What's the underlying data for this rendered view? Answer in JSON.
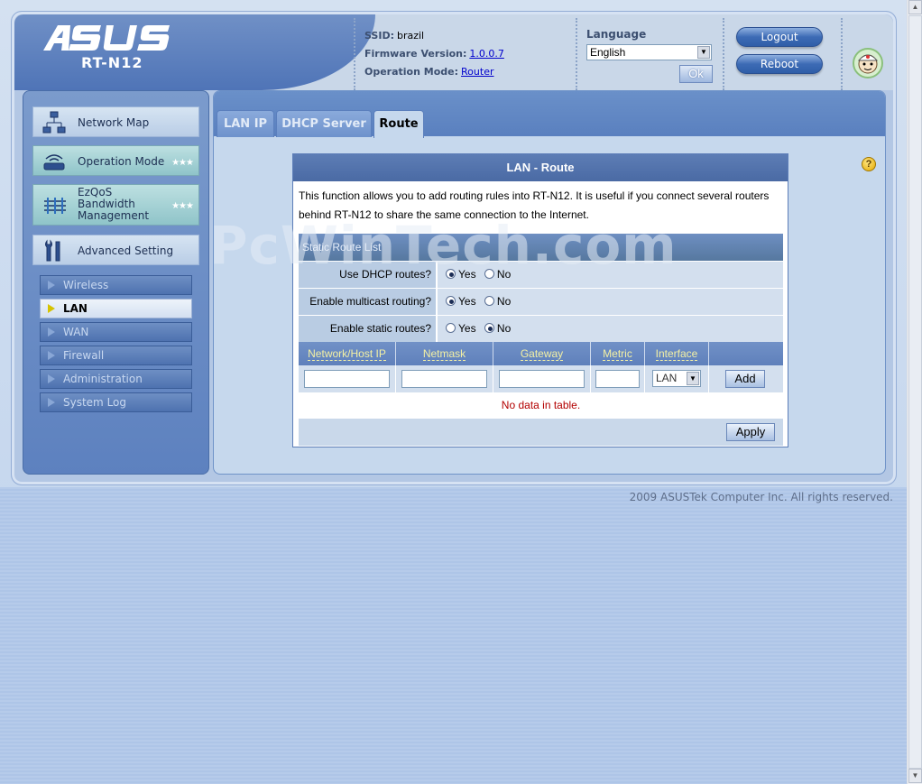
{
  "header": {
    "brand": "ASUS",
    "model": "RT-N12",
    "ssid_label": "SSID:",
    "ssid": "brazil",
    "firmware_label": "Firmware Version:",
    "firmware": "1.0.0.7",
    "opmode_label": "Operation Mode:",
    "opmode": "Router",
    "language_label": "Language",
    "language": "English",
    "ok_label": "Ok",
    "logout_label": "Logout",
    "reboot_label": "Reboot"
  },
  "sidebar": {
    "main": [
      {
        "label": "Network Map",
        "icon": "network-map-icon"
      },
      {
        "label": "Operation Mode",
        "icon": "router-icon"
      },
      {
        "label": "EzQoS Bandwidth Management",
        "label_lines": [
          "EzQoS",
          "Bandwidth",
          "Management"
        ],
        "icon": "qos-icon"
      },
      {
        "label": "Advanced Setting",
        "icon": "tools-icon"
      }
    ],
    "sub": [
      {
        "label": "Wireless",
        "active": false
      },
      {
        "label": "LAN",
        "active": true
      },
      {
        "label": "WAN",
        "active": false
      },
      {
        "label": "Firewall",
        "active": false
      },
      {
        "label": "Administration",
        "active": false
      },
      {
        "label": "System Log",
        "active": false
      }
    ]
  },
  "tabs": [
    {
      "label": "LAN IP",
      "active": false
    },
    {
      "label": "DHCP Server",
      "active": false
    },
    {
      "label": "Route",
      "active": true
    }
  ],
  "panel": {
    "title": "LAN - Route",
    "description": "This function allows you to add routing rules into RT-N12. It is useful if you connect several routers behind RT-N12 to share the same connection to the Internet.",
    "section_title": "Static Route List",
    "options": [
      {
        "label": "Use DHCP routes?",
        "yes": "Yes",
        "no": "No",
        "value": "yes"
      },
      {
        "label": "Enable multicast routing?",
        "yes": "Yes",
        "no": "No",
        "value": "yes"
      },
      {
        "label": "Enable static routes?",
        "yes": "Yes",
        "no": "No",
        "value": "no"
      }
    ],
    "columns": [
      "Network/Host IP",
      "Netmask",
      "Gateway",
      "Metric",
      "Interface"
    ],
    "interface_value": "LAN",
    "add_label": "Add",
    "empty_text": "No data in table.",
    "apply_label": "Apply"
  },
  "watermark": "PcWinTech.com",
  "copyright": "2009 ASUSTek Computer Inc. All rights reserved.",
  "colors": {
    "accent": "#4f74b7",
    "empty_text": "#b30000",
    "column_header_text": "#f3f0a4"
  }
}
